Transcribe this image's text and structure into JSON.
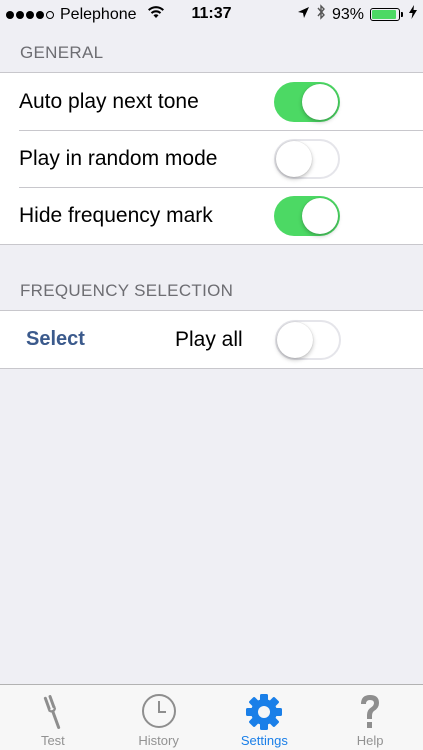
{
  "status_bar": {
    "carrier": "Pelephone",
    "time": "11:37",
    "battery_percent": "93%",
    "battery_level": 0.93,
    "signal_bars_filled": 4,
    "signal_bars_total": 5
  },
  "general": {
    "header": "GENERAL",
    "rows": [
      {
        "label": "Auto play next tone",
        "enabled": true
      },
      {
        "label": "Play in random mode",
        "enabled": false
      },
      {
        "label": "Hide frequency mark",
        "enabled": true
      }
    ]
  },
  "frequency": {
    "header": "FREQUENCY SELECTION",
    "select_label": "Select",
    "play_all_label": "Play all",
    "play_all_enabled": false
  },
  "tabs": [
    {
      "label": "Test",
      "icon": "tuning-fork-icon",
      "active": false
    },
    {
      "label": "History",
      "icon": "clock-icon",
      "active": false
    },
    {
      "label": "Settings",
      "icon": "gear-icon",
      "active": true
    },
    {
      "label": "Help",
      "icon": "question-mark-icon",
      "active": false
    }
  ],
  "colors": {
    "toggle_on": "#4cd964",
    "accent": "#1a7fe8",
    "link": "#3b5a8c",
    "background": "#efeff4"
  }
}
